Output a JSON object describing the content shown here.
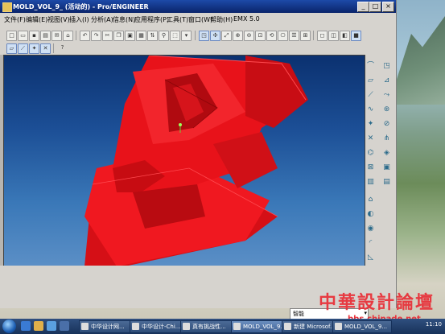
{
  "window": {
    "title": "MOLD_VOL_9_ (活动的) - Pro/ENGINEER"
  },
  "menu": [
    "文件(F)",
    "编辑(E)",
    "视图(V)",
    "插入(I)",
    "分析(A)",
    "信息(N)",
    "应用程序(P)",
    "工具(T)",
    "窗口(W)",
    "帮助(H)",
    "EMX 5.0"
  ],
  "toolbar2_icons": [
    "datum-plane-icon",
    "datum-axis-icon",
    "datum-point-icon",
    "coord-sys-icon",
    "whats-this-icon"
  ],
  "smart_filter": {
    "value": "智能"
  },
  "taskbar": {
    "items": [
      "中华设计网...",
      "中华设计-Chi...",
      "真有挑战性...",
      "MOLD_VOL_9...",
      "新建 Microsof...",
      "MOLD_VOL_9..."
    ],
    "clock": "11:10"
  },
  "watermark": {
    "title": "中華設計論壇",
    "url": "bbs.chinade.net"
  },
  "colors": {
    "model": "#e8121a",
    "viewport_top": "#0b3170",
    "viewport_bottom": "#5b8fc6"
  }
}
